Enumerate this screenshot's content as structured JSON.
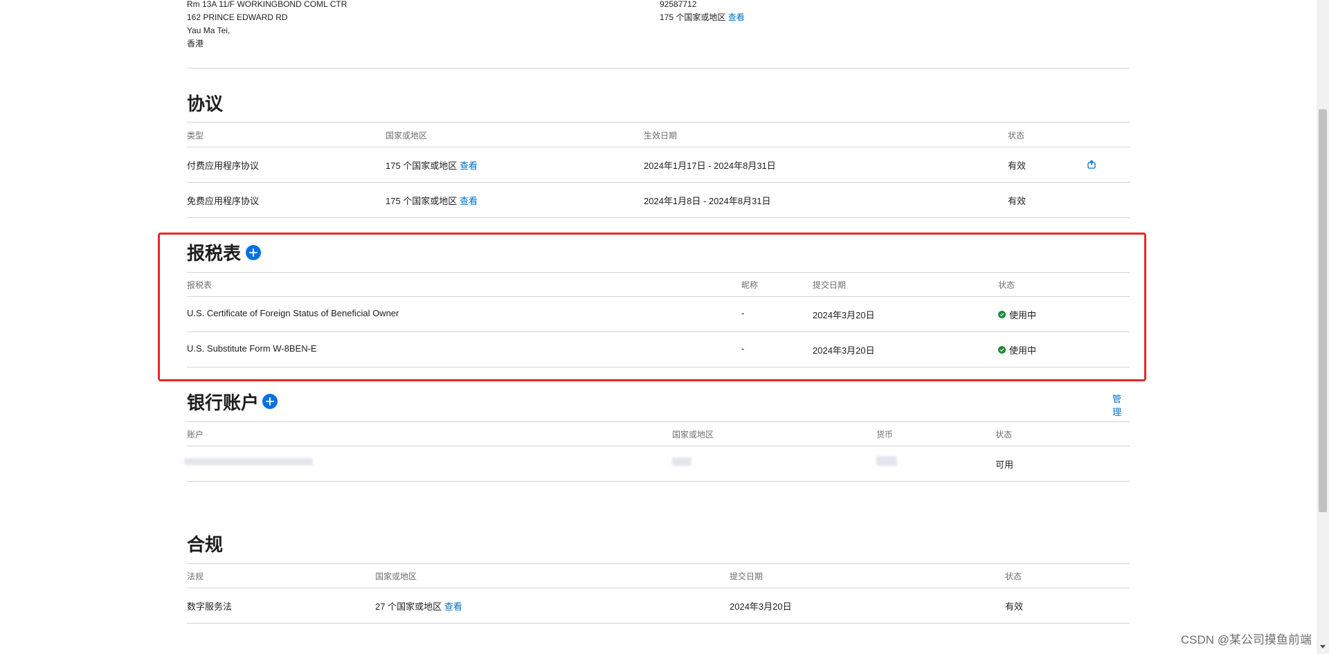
{
  "address": {
    "line1": "Rm 13A 11/F WORKINGBOND COML CTR",
    "line2": "162 PRINCE EDWARD RD",
    "line3": "Yau Ma Tei,",
    "line4": "香港"
  },
  "contact": {
    "phone": "92587712",
    "regions_text": "175 个国家或地区",
    "view_link": "查看"
  },
  "agreements": {
    "title": "协议",
    "headers": {
      "type": "类型",
      "region": "国家或地区",
      "date": "生效日期",
      "status": "状态"
    },
    "rows": [
      {
        "type": "付费应用程序协议",
        "regions": "175 个国家或地区",
        "view": "查看",
        "date": "2024年1月17日 - 2024年8月31日",
        "status": "有效"
      },
      {
        "type": "免费应用程序协议",
        "regions": "175 个国家或地区",
        "view": "查看",
        "date": "2024年1月8日 - 2024年8月31日",
        "status": "有效"
      }
    ]
  },
  "tax": {
    "title": "报税表",
    "headers": {
      "form": "报税表",
      "nickname": "昵称",
      "submit_date": "提交日期",
      "status": "状态"
    },
    "rows": [
      {
        "form": "U.S. Certificate of Foreign Status of Beneficial Owner",
        "nickname": "-",
        "date": "2024年3月20日",
        "status": "使用中"
      },
      {
        "form": "U.S. Substitute Form W-8BEN-E",
        "nickname": "-",
        "date": "2024年3月20日",
        "status": "使用中"
      }
    ]
  },
  "bank": {
    "title": "银行账户",
    "manage": "管理",
    "headers": {
      "account": "账户",
      "region": "国家或地区",
      "currency": "货币",
      "status": "状态"
    },
    "rows": [
      {
        "status": "可用"
      }
    ]
  },
  "compliance": {
    "title": "合规",
    "headers": {
      "law": "法规",
      "region": "国家或地区",
      "submit_date": "提交日期",
      "status": "状态"
    },
    "rows": [
      {
        "law": "数字服务法",
        "regions": "27 个国家或地区",
        "view": "查看",
        "date": "2024年3月20日",
        "status": "有效"
      }
    ]
  },
  "watermark": "CSDN @某公司摸鱼前端",
  "colors": {
    "link": "#0070c9",
    "accent": "#0071e3",
    "highlight": "#e8262b",
    "success": "#1d8b38"
  }
}
